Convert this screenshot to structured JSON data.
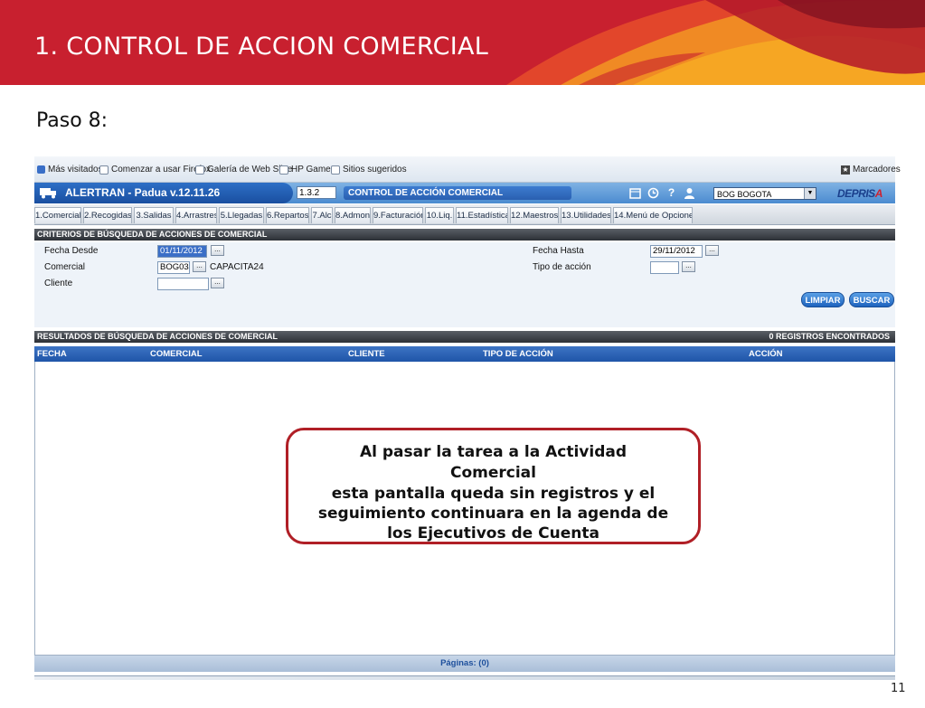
{
  "slide": {
    "title": "1. CONTROL  DE ACCION COMERCIAL",
    "step": "Paso 8:",
    "page_number": "11",
    "header_color": "#c8202f"
  },
  "browser": {
    "bookmarks": [
      "Más visitados",
      "Comenzar a usar Firefox",
      "Galería de Web Slice",
      "HP Games",
      "Sitios sugeridos"
    ],
    "bookmarks_menu": "Marcadores"
  },
  "app": {
    "title": "ALERTRAN - Padua  v.12.11.26",
    "code": "1.3.2",
    "module": "CONTROL DE ACCIÓN COMERCIAL",
    "branch": "BOG BOGOTA",
    "brand_main": "DEPRIS",
    "brand_accent": "A",
    "icons": [
      "calendar-icon",
      "clock-icon",
      "help-icon",
      "user-icon"
    ]
  },
  "menu": {
    "tabs": [
      "1.Comercial",
      "2.Recogidas",
      "3.Salidas",
      "4.Arrastres",
      "5.Llegadas",
      "6.Repartos",
      "7.Alc",
      "8.Admon",
      "9.Facturación",
      "10.Liq.",
      "11.Estadística",
      "12.Maestros",
      "13.Utilidades",
      "14.Menú de Opciones"
    ]
  },
  "criteria": {
    "header": "CRITERIOS DE BÚSQUEDA DE ACCIONES DE COMERCIAL",
    "fecha_desde_label": "Fecha Desde",
    "fecha_desde_value": "01/11/2012",
    "comercial_label": "Comercial",
    "comercial_code": "BOG034",
    "comercial_name": "CAPACITA24",
    "cliente_label": "Cliente",
    "cliente_value": "",
    "fecha_hasta_label": "Fecha Hasta",
    "fecha_hasta_value": "29/11/2012",
    "tipo_label": "Tipo de acción",
    "tipo_value": "",
    "dots": "...",
    "limpiar": "LIMPIAR",
    "buscar": "BUSCAR"
  },
  "results": {
    "header": "RESULTADOS DE BÚSQUEDA DE ACCIONES DE COMERCIAL",
    "count": "0 REGISTROS ENCONTRADOS",
    "columns": [
      "FECHA",
      "COMERCIAL",
      "CLIENTE",
      "TIPO DE ACCIÓN",
      "ACCIÓN"
    ],
    "pages": "Páginas: (0)"
  },
  "callout": {
    "lines": [
      "Al pasar la  tarea a la Actividad",
      "Comercial",
      " esta pantalla queda sin registros y  el",
      "seguimiento continuara en la agenda de",
      "los Ejecutivos de Cuenta"
    ],
    "border_color": "#b01f26"
  }
}
